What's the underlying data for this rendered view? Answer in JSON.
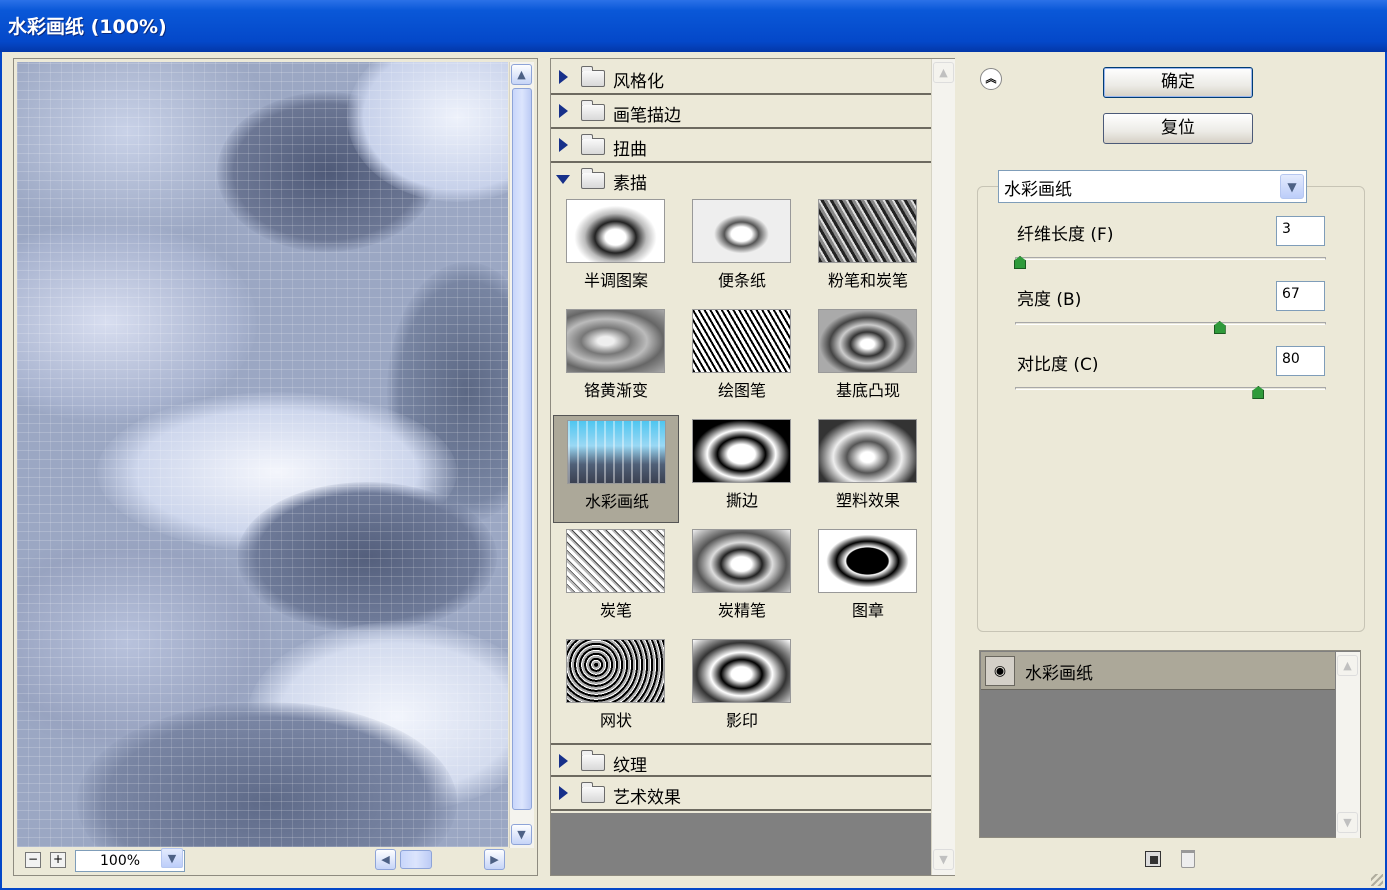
{
  "window": {
    "title": "水彩画纸 (100%)"
  },
  "preview": {
    "zoom": "100%"
  },
  "filter_list": {
    "categories_top": [
      {
        "label": "风格化",
        "expanded": false
      },
      {
        "label": "画笔描边",
        "expanded": false
      },
      {
        "label": "扭曲",
        "expanded": false
      },
      {
        "label": "素描",
        "expanded": true
      }
    ],
    "sketch_filters": [
      "半调图案",
      "便条纸",
      "粉笔和炭笔",
      "铬黄渐变",
      "绘图笔",
      "基底凸现",
      "水彩画纸",
      "撕边",
      "塑料效果",
      "炭笔",
      "炭精笔",
      "图章",
      "网状",
      "影印"
    ],
    "selected_filter": "水彩画纸",
    "categories_bottom": [
      {
        "label": "纹理",
        "expanded": false
      },
      {
        "label": "艺术效果",
        "expanded": false
      }
    ]
  },
  "buttons": {
    "ok": "确定",
    "reset": "复位"
  },
  "settings": {
    "filter_select": "水彩画纸",
    "params": [
      {
        "label": "纤维长度 (F)",
        "value": "3",
        "min": 3,
        "max": 50,
        "level": 0.0
      },
      {
        "label": "亮度 (B)",
        "value": "67",
        "min": 0,
        "max": 100,
        "level": 0.67
      },
      {
        "label": "对比度 (C)",
        "value": "80",
        "min": 0,
        "max": 100,
        "level": 0.8
      }
    ]
  },
  "layers": {
    "items": [
      {
        "label": "水彩画纸",
        "visible": true
      }
    ]
  },
  "icons": [
    "collapse-icon",
    "eye-icon",
    "new-layer-icon",
    "trash-icon",
    "zoom-out-icon",
    "zoom-in-icon"
  ]
}
